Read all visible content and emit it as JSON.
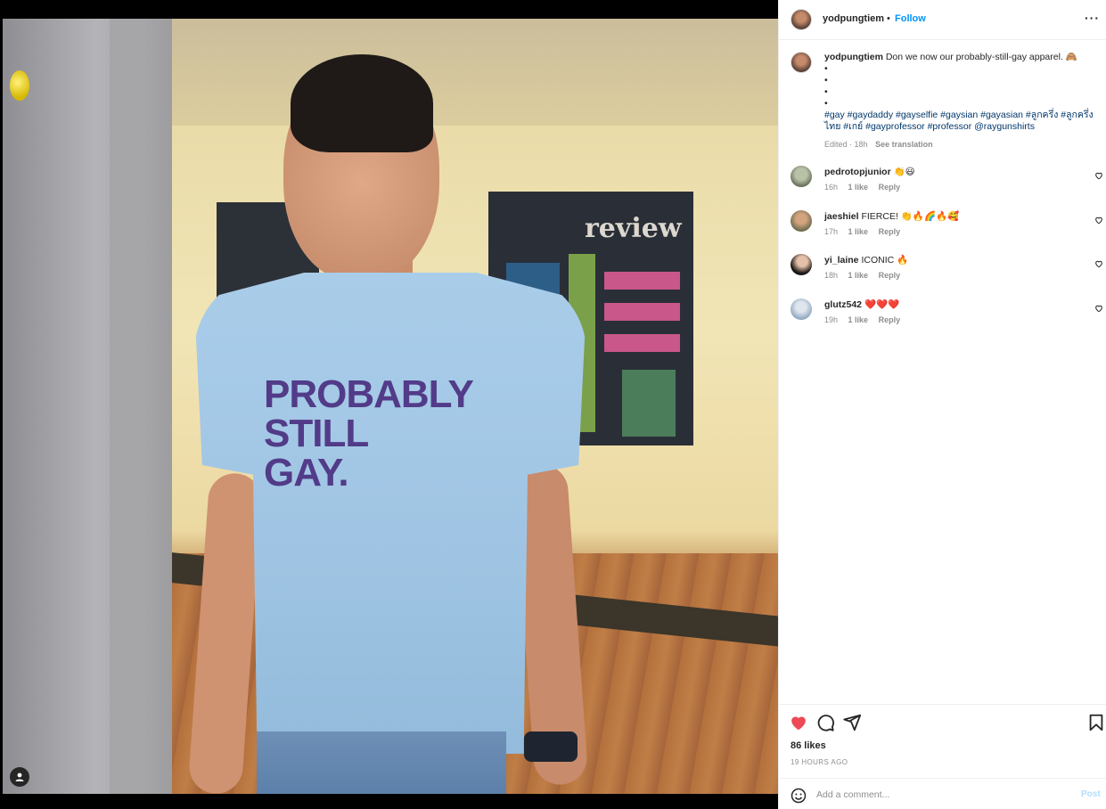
{
  "post": {
    "author": "yodpungtiem",
    "follow_label": "Follow",
    "header_dot": "•",
    "more_label": "···",
    "caption_text": "Don we now our probably-still-gay apparel. 🙈",
    "caption_dots": [
      "•",
      "•",
      "•",
      "•"
    ],
    "hashtags": "#gay #gaydaddy #gayselfie #gaysian #gayasian #ลูกครึ่ง #ลูกครึ่งไทย #เกย์ #gayprofessor #professor @raygunshirts",
    "edited": "Edited · 18h",
    "see_translation": "See translation",
    "shirt_text": [
      "PROBABLY",
      "STILL",
      "GAY."
    ]
  },
  "comments": [
    {
      "user": "pedrotopjunior",
      "text": "👏😃",
      "time": "16h",
      "likes": "1 like",
      "reply": "Reply"
    },
    {
      "user": "jaeshiel",
      "text": "FIERCE! 👏🔥🌈🔥🥰",
      "time": "17h",
      "likes": "1 like",
      "reply": "Reply"
    },
    {
      "user": "yi_laine",
      "text": "ICONIC 🔥",
      "time": "18h",
      "likes": "1 like",
      "reply": "Reply"
    },
    {
      "user": "glutz542",
      "text": "❤️❤️❤️",
      "time": "19h",
      "likes": "1 like",
      "reply": "Reply"
    }
  ],
  "engagement": {
    "likes": "86 likes",
    "time_ago": "19 HOURS AGO",
    "liked": true,
    "like_color": "#ed4956"
  },
  "composer": {
    "placeholder": "Add a comment...",
    "post_label": "Post"
  },
  "poster_word": "review",
  "icons": [
    "person-icon",
    "heart-icon",
    "comment-icon",
    "share-icon",
    "bookmark-icon",
    "emoji-icon"
  ],
  "colors": {
    "link": "#0095f6",
    "hashtag": "#00376b",
    "muted": "#8e8e8e"
  }
}
